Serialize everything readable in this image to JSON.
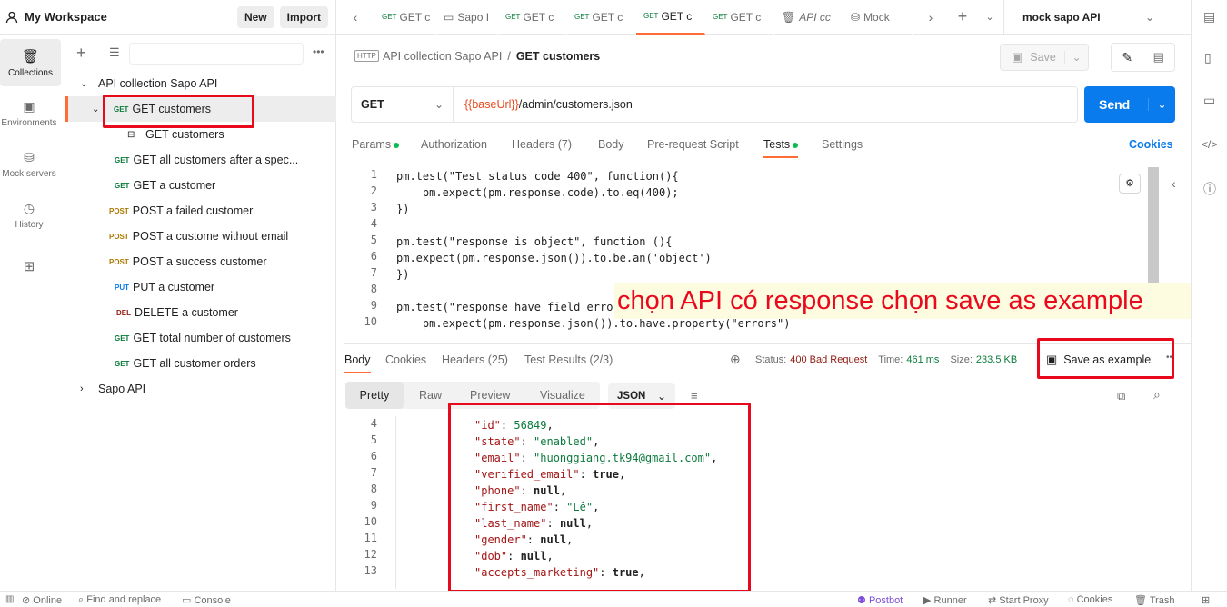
{
  "workspace": {
    "title": "My Workspace",
    "new_label": "New",
    "import_label": "Import"
  },
  "tabs": [
    {
      "method": "GET",
      "label": "GET c"
    },
    {
      "method": "",
      "label": "Sapo I"
    },
    {
      "method": "GET",
      "label": "GET c"
    },
    {
      "method": "GET",
      "label": "GET c"
    },
    {
      "method": "GET",
      "label": "GET c"
    },
    {
      "method": "GET",
      "label": "GET c"
    },
    {
      "method": "",
      "label": "API cc"
    },
    {
      "method": "",
      "label": "Mock"
    }
  ],
  "environment": {
    "selected": "mock sapo API"
  },
  "rail": {
    "collections": "Collections",
    "environments": "Environments",
    "mock_servers": "Mock servers",
    "history": "History"
  },
  "tree": {
    "collection": "API collection Sapo API",
    "items": [
      {
        "method": "GET",
        "label": "GET customers"
      },
      {
        "method": "",
        "label": "GET customers"
      },
      {
        "method": "GET",
        "label": "GET all customers after a spec..."
      },
      {
        "method": "GET",
        "label": "GET a customer"
      },
      {
        "method": "POST",
        "label": "POST a failed customer"
      },
      {
        "method": "POST",
        "label": "POST a custome without email"
      },
      {
        "method": "POST",
        "label": "POST a success customer"
      },
      {
        "method": "PUT",
        "label": "PUT a customer"
      },
      {
        "method": "DEL",
        "label": "DELETE a customer"
      },
      {
        "method": "GET",
        "label": "GET total number of customers"
      },
      {
        "method": "GET",
        "label": "GET all customer orders"
      }
    ],
    "collection2": "Sapo API"
  },
  "breadcrumb": {
    "parent": "API collection Sapo API",
    "sep": "/",
    "current": "GET customers",
    "save_label": "Save"
  },
  "request": {
    "method": "GET",
    "url_var": "{{baseUrl}}",
    "url_path": "/admin/customers.json",
    "send_label": "Send"
  },
  "req_tabs": {
    "params": "Params",
    "authorization": "Authorization",
    "headers": "Headers (7)",
    "body": "Body",
    "prerequest": "Pre-request Script",
    "tests": "Tests",
    "settings": "Settings",
    "cookies": "Cookies"
  },
  "tests_code": [
    {
      "n": "1",
      "text": "pm.test(\"Test status code 400\", function(){"
    },
    {
      "n": "2",
      "text": "    pm.expect(pm.response.code).to.eq(400);"
    },
    {
      "n": "3",
      "text": "})"
    },
    {
      "n": "4",
      "text": ""
    },
    {
      "n": "5",
      "text": "pm.test(\"response is object\", function (){"
    },
    {
      "n": "6",
      "text": "pm.expect(pm.response.json()).to.be.an('object')"
    },
    {
      "n": "7",
      "text": "})"
    },
    {
      "n": "8",
      "text": ""
    },
    {
      "n": "9",
      "text": "pm.test(\"response have field errors\", function(){"
    },
    {
      "n": "10",
      "text": "    pm.expect(pm.response.json()).to.have.property(\"errors\")"
    }
  ],
  "annotation": "chọn API có response chọn save as example",
  "resp_tabs": {
    "body": "Body",
    "cookies": "Cookies",
    "headers": "Headers (25)",
    "test_results": "Test Results (2/3)"
  },
  "status": {
    "status_label": "Status:",
    "status_value": "400 Bad Request",
    "time_label": "Time:",
    "time_value": "461 ms",
    "size_label": "Size:",
    "size_value": "233.5 KB",
    "save_example": "Save as example"
  },
  "resp_view": {
    "pretty": "Pretty",
    "raw": "Raw",
    "preview": "Preview",
    "visualize": "Visualize",
    "format": "JSON"
  },
  "response_code": [
    {
      "n": "4",
      "key": "\"id\"",
      "val": "56849",
      "kind": "num"
    },
    {
      "n": "5",
      "key": "\"state\"",
      "val": "\"enabled\"",
      "kind": "str"
    },
    {
      "n": "6",
      "key": "\"email\"",
      "val": "\"huonggiang.tk94@gmail.com\"",
      "kind": "str"
    },
    {
      "n": "7",
      "key": "\"verified_email\"",
      "val": "true",
      "kind": "kw"
    },
    {
      "n": "8",
      "key": "\"phone\"",
      "val": "null",
      "kind": "kw"
    },
    {
      "n": "9",
      "key": "\"first_name\"",
      "val": "\"Lê\"",
      "kind": "str"
    },
    {
      "n": "10",
      "key": "\"last_name\"",
      "val": "null",
      "kind": "kw"
    },
    {
      "n": "11",
      "key": "\"gender\"",
      "val": "null",
      "kind": "kw"
    },
    {
      "n": "12",
      "key": "\"dob\"",
      "val": "null",
      "kind": "kw"
    },
    {
      "n": "13",
      "key": "\"accepts_marketing\"",
      "val": "true",
      "kind": "kw"
    }
  ],
  "footer": {
    "online": "Online",
    "find": "Find and replace",
    "console": "Console",
    "postbot": "Postbot",
    "runner": "Runner",
    "proxy": "Start Proxy",
    "cookies": "Cookies",
    "trash": "Trash"
  },
  "colors": {
    "accent": "#ff6c37",
    "send": "#097bed",
    "annotation": "#e8091d",
    "annotation_bg": "#fdfbe0"
  }
}
